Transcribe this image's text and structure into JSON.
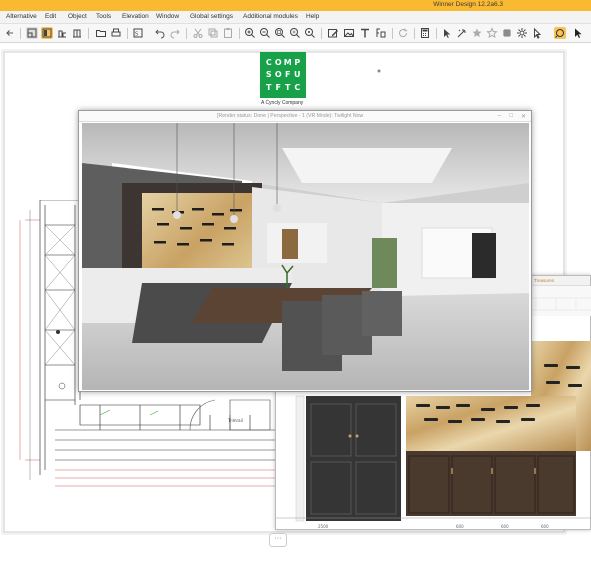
{
  "app": {
    "title": "Winner Design 12.2a6.3"
  },
  "menu": {
    "items": [
      "Alternative",
      "Edit",
      "Object",
      "Tools",
      "Elevation",
      "Window",
      "Global settings",
      "Additional modules",
      "Help"
    ]
  },
  "toolbar": {
    "icons": [
      "back-arrow-icon",
      "floorplan-icon",
      "view-icon",
      "elevation-icon",
      "cabinet-icon",
      "folder-icon",
      "print-icon",
      "export-icon",
      "undo-icon",
      "redo-icon",
      "cut-icon",
      "copy-icon",
      "paste-icon",
      "zoom-in-icon",
      "zoom-out-icon",
      "zoom-fit-icon",
      "zoom-window-icon",
      "edit-icon",
      "image-icon",
      "text-icon",
      "dimension-icon",
      "refresh-icon",
      "calculator-icon",
      "select-icon",
      "magic-icon",
      "star-icon",
      "star-outline-icon",
      "grid-icon",
      "settings-icon",
      "cursor-icon",
      "render-icon",
      "pointer-icon"
    ]
  },
  "logo": {
    "letters": [
      "C",
      "O",
      "M",
      "P",
      "S",
      "O",
      "F",
      "U",
      "T",
      "F",
      "T",
      "C"
    ],
    "tagline": "A Cyncly Company",
    "color": "#17a24a"
  },
  "render_window": {
    "title": "[Render status: Done | Perspective - 1 (VR Mode): Twilight Now",
    "min_label": "–",
    "max_label": "□",
    "close_label": "✕"
  },
  "elevation_window": {
    "title": "Treasures"
  },
  "floating_button": {
    "label": "···"
  },
  "colors": {
    "titlebar": "#f9b931",
    "accent": "#f7c45a",
    "logo_green": "#17a24a"
  }
}
